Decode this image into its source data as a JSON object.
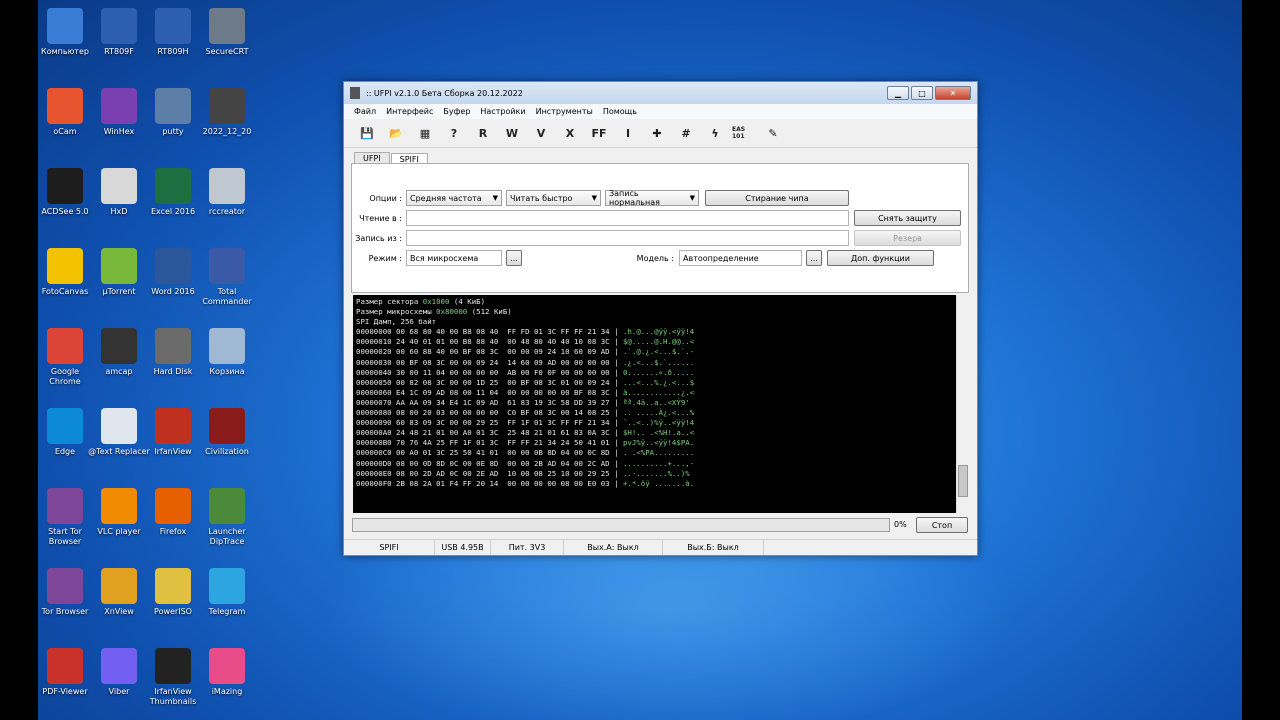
{
  "desktop_icons": [
    {
      "label": "Компьютер",
      "icon": "computer-icon",
      "color": "#3a7bd5"
    },
    {
      "label": "RT809F",
      "icon": "ifixfrog-icon",
      "color": "#2d5fb0"
    },
    {
      "label": "RT809H",
      "icon": "ifixfrog-icon",
      "color": "#2d5fb0"
    },
    {
      "label": "SecureCRT",
      "icon": "securecrt-icon",
      "color": "#6c7a89"
    },
    {
      "label": "oCam",
      "icon": "ocam-icon",
      "color": "#e8542f"
    },
    {
      "label": "WinHex",
      "icon": "winhex-icon",
      "color": "#7a3fb0"
    },
    {
      "label": "putty",
      "icon": "putty-icon",
      "color": "#5d7ea6"
    },
    {
      "label": "2022_12_20",
      "icon": "chip-icon",
      "color": "#444444"
    },
    {
      "label": "ACDSee 5.0",
      "icon": "acdsee-icon",
      "color": "#1d1d1d"
    },
    {
      "label": "HxD",
      "icon": "hxd-icon",
      "color": "#d8d8d8"
    },
    {
      "label": "Excel 2016",
      "icon": "excel-icon",
      "color": "#1d6f42"
    },
    {
      "label": "rccreator",
      "icon": "rccreator-icon",
      "color": "#bfc7d1"
    },
    {
      "label": "FotoCanvas",
      "icon": "fotocanvas-icon",
      "color": "#f2c200"
    },
    {
      "label": "µTorrent",
      "icon": "utorrent-icon",
      "color": "#78b83a"
    },
    {
      "label": "Word 2016",
      "icon": "word-icon",
      "color": "#2b579a"
    },
    {
      "label": "Total Commander",
      "icon": "floppy-icon",
      "color": "#3a5aa8"
    },
    {
      "label": "Google Chrome",
      "icon": "chrome-icon",
      "color": "#db4437"
    },
    {
      "label": "amcap",
      "icon": "camera-icon",
      "color": "#333333"
    },
    {
      "label": "Hard Disk",
      "icon": "harddisk-icon",
      "color": "#6b6b6b"
    },
    {
      "label": "Корзина",
      "icon": "recycle-bin-icon",
      "color": "#9fb9d4"
    },
    {
      "label": "Edge",
      "icon": "edge-icon",
      "color": "#0c8ad8"
    },
    {
      "label": "@Text Replacer",
      "icon": "text-replacer-icon",
      "color": "#dfe6ee"
    },
    {
      "label": "IrfanView",
      "icon": "irfanview-icon",
      "color": "#c0301e"
    },
    {
      "label": "Civilization",
      "icon": "civilization-icon",
      "color": "#8a1b1b"
    },
    {
      "label": "Start Tor Browser",
      "icon": "tor-icon",
      "color": "#7d4698"
    },
    {
      "label": "VLC player",
      "icon": "vlc-icon",
      "color": "#f08a00"
    },
    {
      "label": "Firefox",
      "icon": "firefox-icon",
      "color": "#e66000"
    },
    {
      "label": "Launcher DipTrace",
      "icon": "diptrace-icon",
      "color": "#4a8a3a"
    },
    {
      "label": "Tor Browser",
      "icon": "tor-icon",
      "color": "#7d4698"
    },
    {
      "label": "XnView",
      "icon": "xnview-icon",
      "color": "#e0a020"
    },
    {
      "label": "PowerISO",
      "icon": "poweriso-icon",
      "color": "#e0c040"
    },
    {
      "label": "Telegram",
      "icon": "telegram-icon",
      "color": "#2ca5e0"
    },
    {
      "label": "PDF-Viewer",
      "icon": "pdf-icon",
      "color": "#c8322a"
    },
    {
      "label": "Viber",
      "icon": "viber-icon",
      "color": "#7360f2"
    },
    {
      "label": "IrfanView Thumbnails",
      "icon": "panda-icon",
      "color": "#222222"
    },
    {
      "label": "iMazing",
      "icon": "imazing-icon",
      "color": "#e84d8a"
    }
  ],
  "window": {
    "title": ":: UFPI v2.1.0 Бета Сборка 20.12.2022",
    "menu": [
      "Файл",
      "Интерфейс",
      "Буфер",
      "Настройки",
      "Инструменты",
      "Помощь"
    ],
    "toolbar": [
      {
        "icon": "save-icon",
        "glyph": "💾"
      },
      {
        "icon": "open-folder-icon",
        "glyph": "📂"
      },
      {
        "icon": "chip-icon",
        "glyph": "▦"
      },
      {
        "icon": "detect-icon",
        "glyph": "?"
      },
      {
        "icon": "read-icon",
        "glyph": "R"
      },
      {
        "icon": "write-icon",
        "glyph": "W"
      },
      {
        "icon": "verify-icon",
        "glyph": "V"
      },
      {
        "icon": "erase-icon",
        "glyph": "X"
      },
      {
        "icon": "blank-check-icon",
        "glyph": "FF"
      },
      {
        "icon": "protect-icon",
        "glyph": "ꓲ"
      },
      {
        "icon": "plus-icon",
        "glyph": "✚"
      },
      {
        "icon": "hash-icon",
        "glyph": "#"
      },
      {
        "icon": "lightning-icon",
        "glyph": "ϟ"
      },
      {
        "icon": "eas101-icon",
        "glyph": "EAS 101"
      },
      {
        "icon": "edit-icon",
        "glyph": "✎"
      }
    ],
    "tabs": [
      "UFPI",
      "SPIFI"
    ],
    "form": {
      "options_label": "Опции :",
      "freq": "Средняя частота",
      "read_mode": "Читать быстро",
      "write_mode": "Запись нормальная",
      "erase_chip": "Стирание чипа",
      "read_to_label": "Чтение в :",
      "read_to_value": "",
      "unprotect": "Снять защиту",
      "write_from_label": "Запись из :",
      "write_from_value": "",
      "reserve": "Резерв",
      "mode_label": "Режим :",
      "mode_value": "Вся микросхема",
      "browse": "...",
      "model_label": "Модель :",
      "model_value": "Автоопределение",
      "extra_funcs": "Доп. функции"
    },
    "console": {
      "sector_size_label": "Размер сектора ",
      "sector_size_hex": "0x1000",
      "sector_size_kb": " (4 КиБ)",
      "chip_size_label": "Размер микросхемы ",
      "chip_size_hex": "0x80000",
      "chip_size_kb": " (512 КиБ)",
      "dump_header": "SPI Дамп, 256 байт",
      "lines": [
        {
          "hex": "00000000 00 68 80 40 00 B8 08 40  FF FD 01 3C FF FF 21 34 | ",
          "ascii": ".h.@...@ýÿ.<ÿÿ!4"
        },
        {
          "hex": "00000010 24 40 01 01 00 B8 88 40  00 48 80 40 40 10 08 3C | ",
          "ascii": "$@.....@.H.@@..<"
        },
        {
          "hex": "00000020 00 60 88 40 00 BF 08 3C  00 00 09 24 10 60 09 AD | ",
          "ascii": ".`.@.¿.<...$.`.-"
        },
        {
          "hex": "00000030 00 BF 08 3C 00 00 09 24  14 60 09 AD 00 00 00 00 | ",
          "ascii": ".¿.<...$.`......"
        },
        {
          "hex": "00000040 30 00 11 04 00 00 00 00  AB 00 F0 0F 00 00 00 00 | ",
          "ascii": "0.......«.ð....."
        },
        {
          "hex": "00000050 00 82 08 3C 00 00 1D 25  00 BF 08 3C 01 00 09 24 | ",
          "ascii": "...<...%.¿.<...$"
        },
        {
          "hex": "00000060 E4 1C 09 AD 08 00 11 04  00 00 00 00 00 BF 08 3C | ",
          "ascii": "ä............¿.<"
        },
        {
          "hex": "00000070 AA AA 09 34 E4 1C 09 AD  61 83 19 3C 58 DD 39 27 | ",
          "ascii": "ªª.4ä..a..<XÝ9'"
        },
        {
          "hex": "00000080 08 00 20 03 00 00 00 00  C0 BF 08 3C 00 14 08 25 | ",
          "ascii": ".. .....À¿.<...%"
        },
        {
          "hex": "00000090 60 83 09 3C 00 00 29 25  FF 1F 01 3C FF FF 21 34 | ",
          "ascii": "`..<..)%ÿ..<ÿÿ!4"
        },
        {
          "hex": "000000A0 24 48 21 01 00 A0 01 3C  25 48 21 01 61 83 0A 3C | ",
          "ascii": "$H!.. .<%H!.a..<"
        },
        {
          "hex": "000000B0 70 76 4A 25 FF 1F 01 3C  FF FF 21 34 24 50 41 01 | ",
          "ascii": "pvJ%ÿ..<ÿÿ!4$PA."
        },
        {
          "hex": "000000C0 00 A0 01 3C 25 50 41 01  00 00 0B 8D 04 00 0C 8D | ",
          "ascii": ". .<%PA........."
        },
        {
          "hex": "000000D0 08 00 0D 8D 0C 00 0E 8D  00 00 2B AD 04 00 2C AD | ",
          "ascii": "..........+...,-"
        },
        {
          "hex": "000000E0 08 00 2D AD 0C 00 2E AD  10 00 08 25 10 00 29 25 | ",
          "ascii": "..-.......%..)%"
        },
        {
          "hex": "000000F0 2B 08 2A 01 F4 FF 20 14  00 00 00 00 08 00 E0 03 | ",
          "ascii": "+.*.ôÿ .......à."
        }
      ]
    },
    "progress": {
      "value": 0,
      "label": "0%"
    },
    "stop": "Стоп",
    "status": [
      "SPIFI",
      "USB 4.95В",
      "Пит. 3V3",
      "Вых.А: Выкл",
      "Вых.Б: Выкл"
    ]
  }
}
